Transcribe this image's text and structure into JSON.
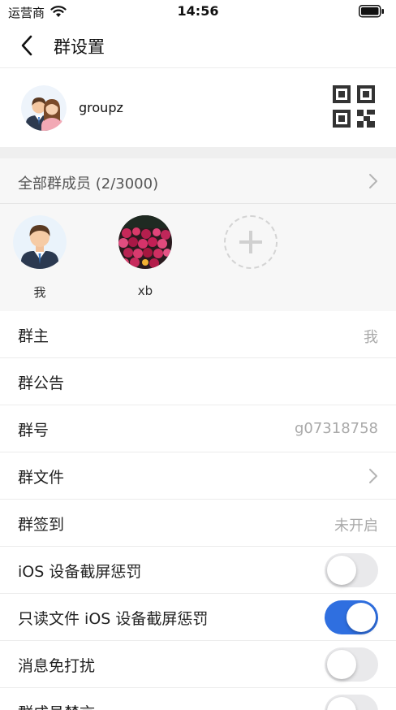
{
  "status_bar": {
    "carrier": "运营商",
    "time": "14:56"
  },
  "nav": {
    "title": "群设置"
  },
  "group": {
    "name": "groupz"
  },
  "members": {
    "header": "全部群成员 (2/3000)",
    "list": [
      {
        "name": "我"
      },
      {
        "name": "xb"
      }
    ]
  },
  "settings": [
    {
      "label": "群主",
      "value": "我"
    },
    {
      "label": "群公告"
    },
    {
      "label": "群号",
      "value": "g07318758"
    },
    {
      "label": "群文件"
    },
    {
      "label": "群签到",
      "value": "未开启"
    },
    {
      "label": "iOS 设备截屏惩罚",
      "toggle": false
    },
    {
      "label": "只读文件 iOS 设备截屏惩罚",
      "toggle": true
    },
    {
      "label": "消息免打扰",
      "toggle": false
    },
    {
      "label": "群成员禁言",
      "toggle": false
    }
  ],
  "colors": {
    "accent": "#2f6fe0",
    "section_gap": "#efefef",
    "secondary_text": "#a9a9a9"
  }
}
